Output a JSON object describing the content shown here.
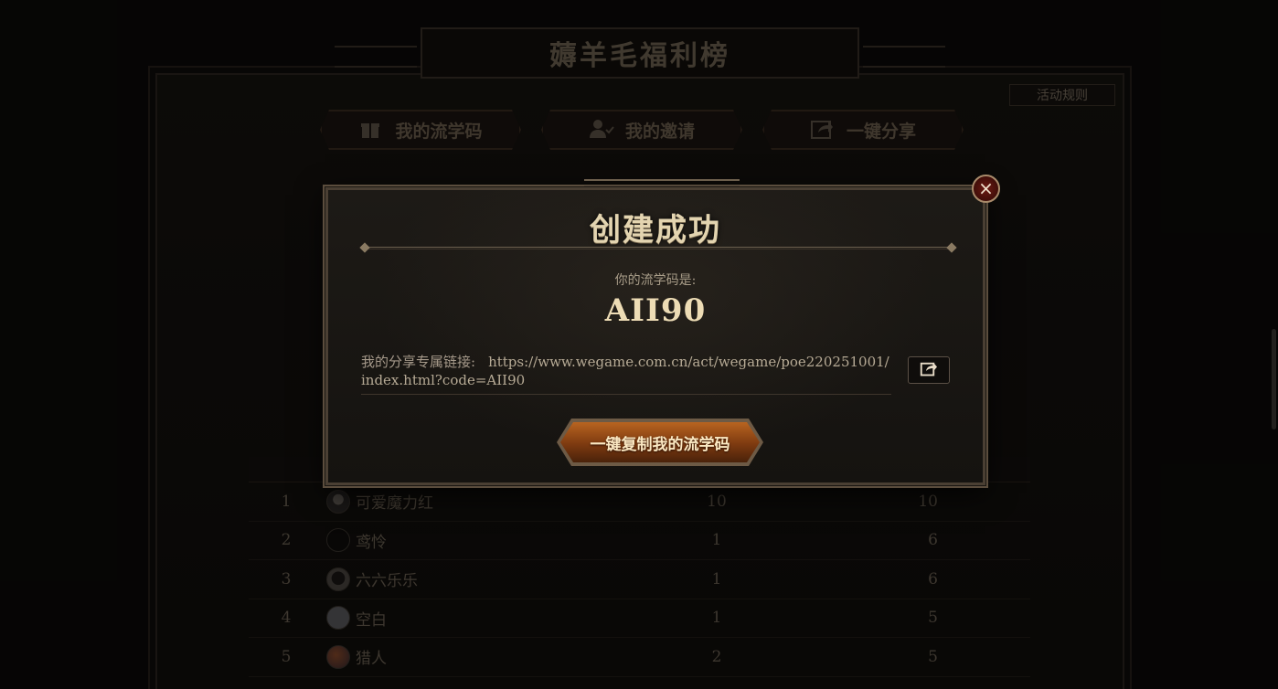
{
  "page": {
    "title": "薅羊毛福利榜",
    "rules_label": "活动规则",
    "tabs": [
      {
        "label": "我的流学码",
        "icon": "gift-icon"
      },
      {
        "label": "我的邀请",
        "icon": "user-check-icon"
      },
      {
        "label": "一键分享",
        "icon": "share-icon"
      }
    ]
  },
  "ranking": {
    "rows": [
      {
        "rank": "1",
        "name": "可爱魔力红",
        "a": "10",
        "b": "10"
      },
      {
        "rank": "2",
        "name": "鸢怜",
        "a": "1",
        "b": "6"
      },
      {
        "rank": "3",
        "name": "六六乐乐",
        "a": "1",
        "b": "6"
      },
      {
        "rank": "4",
        "name": "空白",
        "a": "1",
        "b": "5"
      },
      {
        "rank": "5",
        "name": "猎人",
        "a": "2",
        "b": "5"
      }
    ]
  },
  "modal": {
    "title": "创建成功",
    "code_label": "你的流学码是:",
    "code_value": "AII90",
    "link_label": "我的分享专属链接:",
    "link_url": "https://www.wegame.com.cn/act/wegame/poe220251001/index.html?code=AII90",
    "copy_button": "一键复制我的流学码",
    "close_symbol": "×"
  }
}
